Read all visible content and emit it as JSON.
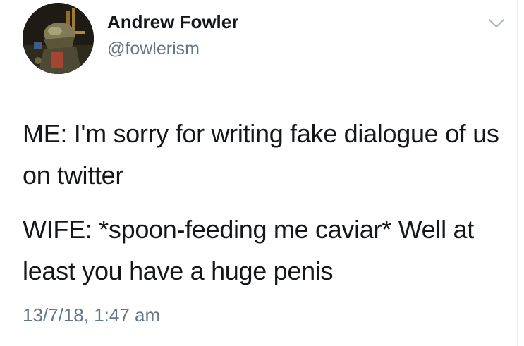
{
  "tweet": {
    "author": {
      "name": "Andrew Fowler",
      "handle": "@fowlerism"
    },
    "paragraphs": [
      "ME: I'm sorry for writing fake dialogue of us on twitter",
      "WIFE: *spoon-feeding me caviar* Well at least you have a huge penis"
    ],
    "timestamp": "13/7/18, 1:47 am"
  },
  "icons": {
    "menu": "chevron-down-icon",
    "avatar": "avatar-image"
  },
  "colors": {
    "text": "#14171a",
    "secondary_text": "#657786",
    "chevron": "#aab8c2",
    "background": "#ffffff"
  }
}
